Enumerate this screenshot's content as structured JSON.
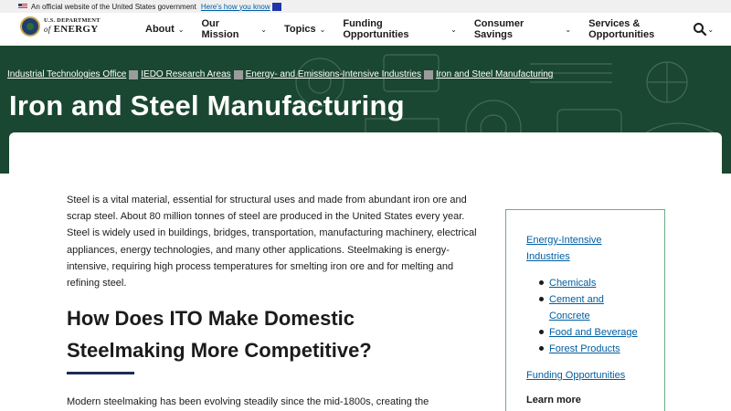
{
  "gov_banner": {
    "text": "An official website of the United States government",
    "link": "Here's how you know"
  },
  "logo": {
    "line1": "U.S. DEPARTMENT",
    "line2_prefix": "of",
    "line2": "ENERGY"
  },
  "nav": {
    "items": [
      {
        "label": "About"
      },
      {
        "label": "Our Mission"
      },
      {
        "label": "Topics"
      },
      {
        "label": "Funding Opportunities"
      },
      {
        "label": "Consumer Savings"
      },
      {
        "label": "Services & Opportunities"
      }
    ],
    "search_icon": "search-icon"
  },
  "breadcrumb": [
    "Industrial Technologies Office",
    "IEDO Research Areas",
    "Energy- and Emissions-Intensive Industries",
    "Iron and Steel Manufacturing"
  ],
  "page": {
    "title": "Iron and Steel Manufacturing",
    "intro": "Steel is a vital material, essential for structural uses and made from abundant iron ore and scrap steel. About 80 million tonnes of steel are produced in the United States every year. Steel is widely used in buildings, bridges, transportation, manufacturing machinery, electrical appliances, energy technologies, and many other applications. Steelmaking is energy-intensive, requiring high process temperatures for smelting iron ore and for melting and refining steel.",
    "h2": "How Does ITO Make Domestic Steelmaking More Competitive?",
    "para2": "Modern steelmaking has been evolving steadily since the mid-1800s, creating the"
  },
  "sidebar": {
    "heading_link": "Energy-Intensive Industries",
    "items": [
      "Chemicals",
      "Cement and Concrete",
      "Food and Beverage",
      "Forest Products"
    ],
    "funding_link": "Funding Opportunities",
    "learn_more": "Learn more"
  },
  "colors": {
    "hero_bg": "#1a4731",
    "link": "#005ea2",
    "sidebar_border": "#6ea98a",
    "h2_rule": "#1c2b5a"
  }
}
